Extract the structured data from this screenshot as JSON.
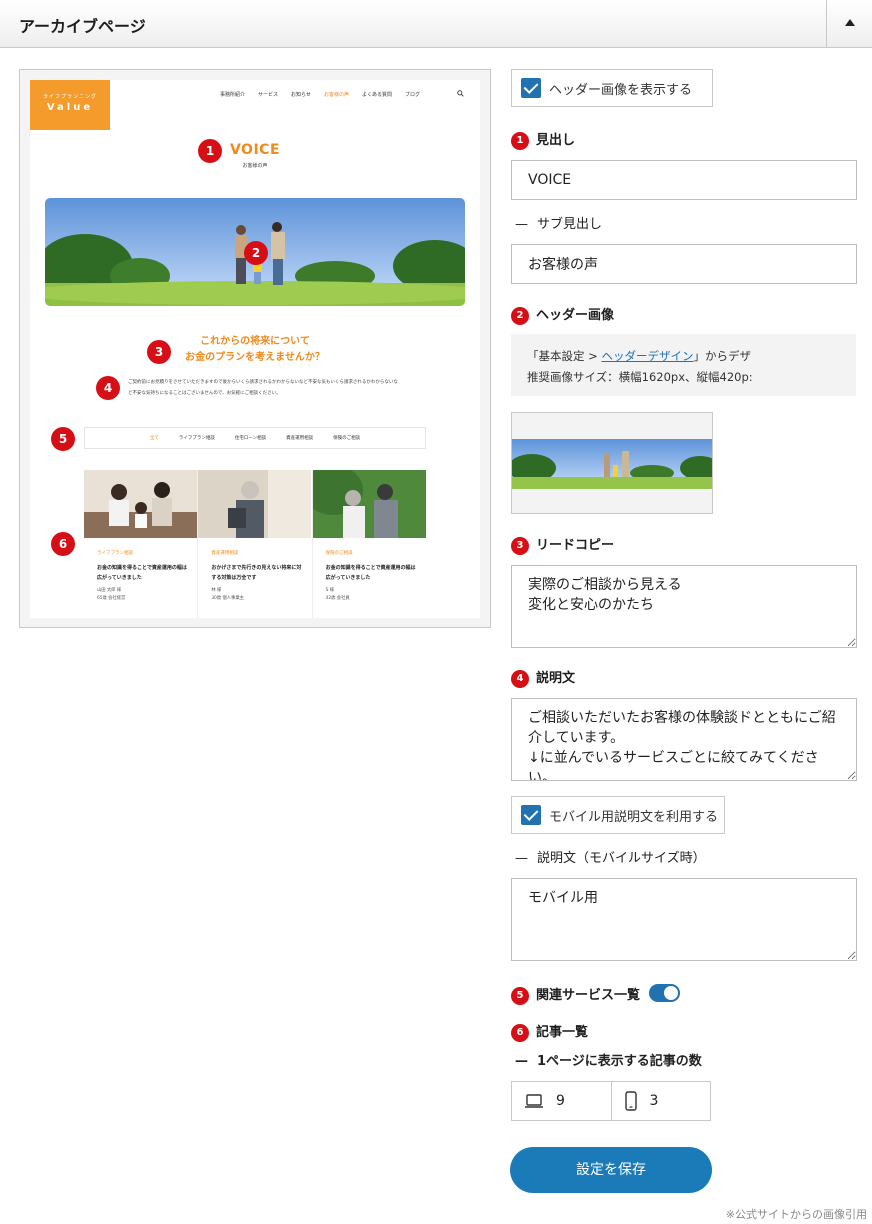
{
  "panel": {
    "title": "アーカイブページ"
  },
  "preview": {
    "logo_sub": "ライフプランニング",
    "logo_main": "Value",
    "nav": [
      "事務所紹介",
      "サービス",
      "お知らせ",
      "お客様の声",
      "よくある質問",
      "ブログ"
    ],
    "title": "VOICE",
    "subtitle": "お客様の声",
    "lead_line1": "これからの将来について",
    "lead_line2": "お金のプランを考えませんか？",
    "description": "ご契約前にお見積りをさせていただきますので後からいくら請求されるかわからないなど不安な気もいくら請求されるかわからないなど不安な気持ちになることはございませんので、お気軽にご相談ください。",
    "tabs": [
      "全て",
      "ライフプラン相談",
      "住宅ローン相談",
      "資産運用相談",
      "保険のご相談"
    ],
    "cards": [
      {
        "category": "ライフプラン相談",
        "title": "お金の知識を得ることで資産運用の幅は広がっていきました",
        "meta": "山田 太郎 様\n65歳 会社経営"
      },
      {
        "category": "資産運用相談",
        "title": "おかげさまで先行きの見えない将来に対する対策は万全です",
        "meta": "林 様\n30歳 個人事業主"
      },
      {
        "category": "保険のご相談",
        "title": "お金の知識を得ることで資産運用の幅は広がっていきました",
        "meta": "S 様\n42歳 会社員"
      }
    ],
    "badges": [
      "1",
      "2",
      "3",
      "4",
      "5",
      "6"
    ]
  },
  "form": {
    "show_header_label": "ヘッダー画像を表示する",
    "heading": {
      "badge": "1",
      "label": "見出し",
      "value": "VOICE"
    },
    "subheading": {
      "dash": "—",
      "label": "サブ見出し",
      "value": "お客様の声"
    },
    "header_image": {
      "badge": "2",
      "label": "ヘッダー画像",
      "note_prefix": "「基本設定 > ",
      "note_link": "ヘッダーデザイン",
      "note_suffix": "」からデザ",
      "note_line2": "推奨画像サイズ：横幅1620px、縦幅420p:"
    },
    "lead_copy": {
      "badge": "3",
      "label": "リードコピー",
      "value": "実際のご相談から見える\n変化と安心のかたち"
    },
    "description": {
      "badge": "4",
      "label": "説明文",
      "value": "ご相談いただいたお客様の体験談ドとともにご紹介しています。\n↓に並んでいるサービスごとに絞てみてください。"
    },
    "mobile_description_label": "モバイル用説明文を利用する",
    "mobile_description": {
      "dash": "—",
      "label": "説明文（モバイルサイズ時）",
      "value": "モバイル用"
    },
    "related_services": {
      "badge": "5",
      "label": "関連サービス一覧"
    },
    "articles": {
      "badge": "6",
      "label": "記事一覧",
      "per_page_dash": "—",
      "per_page_label": "1ページに表示する記事の数",
      "desktop_count": "9",
      "mobile_count": "3"
    },
    "save_label": "設定を保存"
  },
  "credit": "※公式サイトからの画像引用",
  "colors": {
    "accent_orange": "#f08a1c",
    "badge_red": "#d60f16",
    "wp_blue": "#2271b1",
    "save_blue": "#1b7bb8"
  },
  "icons": [
    "laptop-icon",
    "smartphone-icon",
    "search-icon",
    "checkbox-checked-icon",
    "collapse-arrow-icon"
  ]
}
